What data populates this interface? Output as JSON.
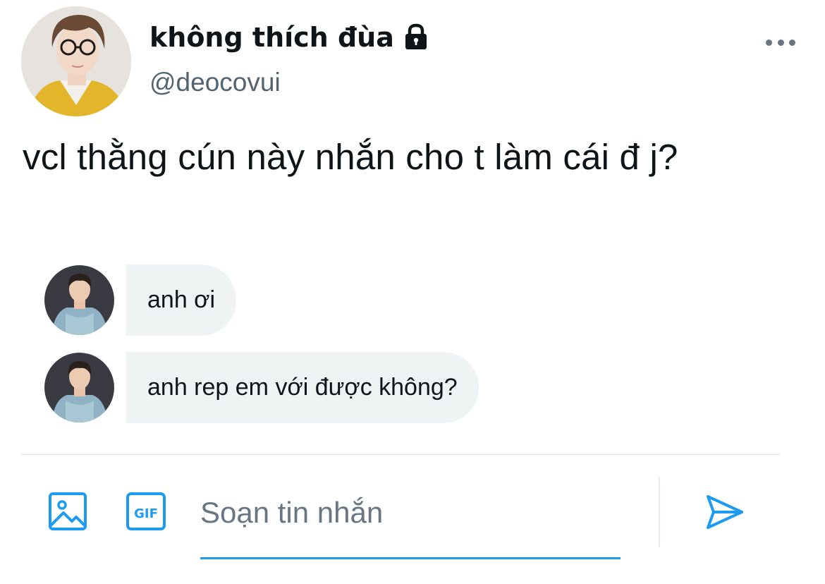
{
  "tweet": {
    "display_name": "không thích đùa",
    "handle": "@deocovui",
    "protected_icon": "lock-icon",
    "text": "vcl thằng cún này nhắn cho t làm cái đ j?"
  },
  "dm": {
    "messages": [
      {
        "text": "anh ơi"
      },
      {
        "text": "anh rep em với được không?"
      }
    ]
  },
  "composer": {
    "placeholder": "Soạn tin nhắn",
    "value": "",
    "gif_label": "GIF"
  },
  "colors": {
    "accent": "#1d9bf0",
    "bubble_bg": "#eff3f4",
    "secondary_text": "#536471",
    "primary_text": "#0f1419"
  }
}
